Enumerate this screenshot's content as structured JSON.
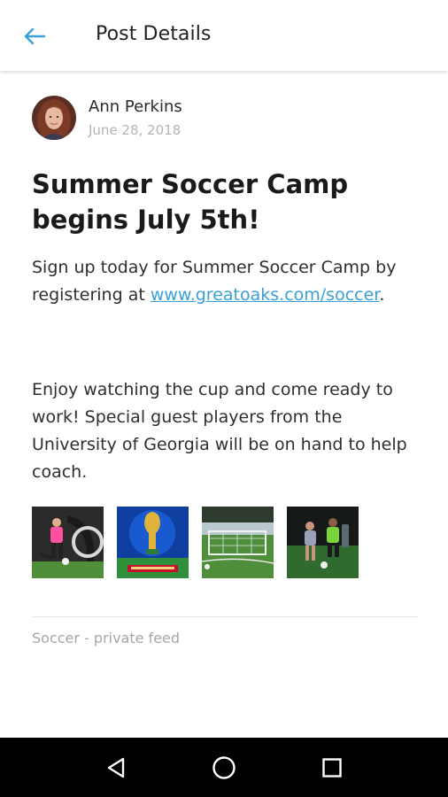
{
  "app_bar": {
    "title": "Post Details",
    "back_icon": "arrow-left-icon",
    "accent_color": "#3a9fd4"
  },
  "post": {
    "author_name": "Ann Perkins",
    "date": "June 28, 2018",
    "title": "Summer Soccer Camp begins July 5th!",
    "paragraph1_before_link": "Sign up today for Summer Soccer Camp by registering at ",
    "link_text": "www.greatoaks.com/soccer",
    "paragraph1_after_link": ".",
    "paragraph2": "Enjoy watching the cup and come ready to work! Special guest players from the University of Georgia will be on hand to help coach.",
    "images": [
      "player-in-pink-photo",
      "world-cup-trophy-poster",
      "soccer-field-goal-photo",
      "players-night-match-photo"
    ],
    "feed_label": "Soccer - private feed"
  },
  "nav": {
    "back": "triangle-back-icon",
    "home": "circle-home-icon",
    "recents": "square-recents-icon"
  }
}
